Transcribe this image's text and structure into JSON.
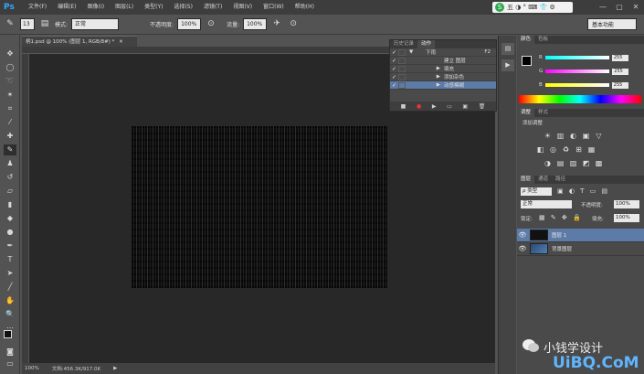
{
  "app": {
    "logo": "Ps"
  },
  "menu": [
    "文件(F)",
    "编辑(E)",
    "图像(I)",
    "图层(L)",
    "类型(Y)",
    "选择(S)",
    "滤镜(T)",
    "视图(V)",
    "窗口(W)",
    "帮助(H)"
  ],
  "ime": {
    "logo_char": "S",
    "label": "五 ◑ ° ⌨ 👕 ⚙"
  },
  "window_controls": [
    "—",
    "▢",
    "✕"
  ],
  "options_bar": {
    "brush_size": "13",
    "mode_label": "模式:",
    "mode_value": "正常",
    "opacity_label": "不透明度:",
    "opacity_value": "100%",
    "flow_label": "流量:",
    "flow_value": "100%"
  },
  "workspace": "基本功能",
  "document": {
    "tab_title": "柄1.psd @ 100% (图层 1, RGB/8#) *",
    "tab_close": "✕"
  },
  "status": {
    "zoom": "100%",
    "doc_info": "文档:456.3K/917.0K"
  },
  "actions_panel": {
    "tabs": [
      "历史记录",
      "动作"
    ],
    "active_tab": 1,
    "rows": [
      {
        "check": "✓",
        "arrow": "▼",
        "label": "下雨",
        "shortcut": "F2"
      },
      {
        "check": "✓",
        "arrow": "",
        "label": "建立 图层",
        "shortcut": ""
      },
      {
        "check": "✓",
        "arrow": "▶",
        "label": "填充",
        "shortcut": ""
      },
      {
        "check": "✓",
        "arrow": "▶",
        "label": "添加杂色",
        "shortcut": ""
      },
      {
        "check": "✓",
        "arrow": "▶",
        "label": "动感模糊",
        "shortcut": ""
      }
    ],
    "buttons": [
      "■",
      "●",
      "▶",
      "▭",
      "▣",
      "🗑"
    ]
  },
  "color_panel": {
    "tabs": [
      "颜色",
      "色板"
    ],
    "channels": [
      {
        "label": "R",
        "value": "255",
        "color": "#ff5a5a"
      },
      {
        "label": "G",
        "value": "255",
        "color": "#5aff5a"
      },
      {
        "label": "B",
        "value": "255",
        "color": "#5a9bff"
      }
    ]
  },
  "adjustments_panel": {
    "tabs": [
      "调整",
      "样式"
    ],
    "title": "添加调整",
    "icons": [
      "☀",
      "▥",
      "◐",
      "▣",
      "▽",
      "◧",
      "◎",
      "♻",
      "⊞",
      "▦",
      "◑",
      "▤",
      "▨",
      "◩",
      "▩"
    ]
  },
  "layers_panel": {
    "tabs": [
      "图层",
      "通道",
      "路径"
    ],
    "filter_label": "ρ 类型",
    "blend_mode": "正常",
    "opacity_label": "不透明度:",
    "opacity_value": "100%",
    "lock_label": "锁定:",
    "fill_label": "填充:",
    "fill_value": "100%",
    "layers": [
      {
        "name": "图层 1",
        "selected": true,
        "eye": "👁"
      },
      {
        "name": "背景图层",
        "selected": false,
        "eye": "👁"
      }
    ]
  },
  "watermark": {
    "text": "小钱学设计",
    "site": "UiBQ.CoM"
  }
}
